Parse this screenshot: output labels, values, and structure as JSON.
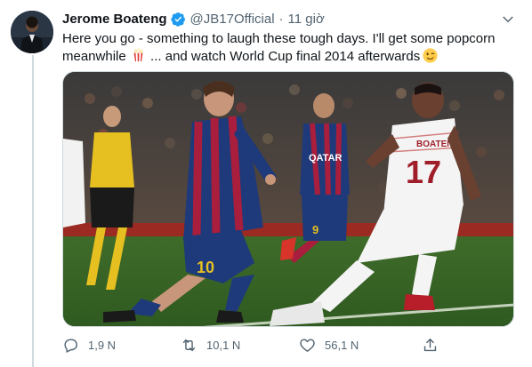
{
  "tweet": {
    "display_name": "Jerome Boateng",
    "handle": "@JB17Official",
    "separator": "·",
    "timestamp": "11 giờ",
    "text_part1": "Here you go - something to laugh these tough days. I'll get some popcorn meanwhile",
    "text_part2": " ... and watch World Cup final 2014 afterwards",
    "emoji_popcorn": "popcorn-emoji",
    "emoji_wink": "winking-face-emoji",
    "verified_color": "#1d9bf0"
  },
  "media": {
    "jersey_number_left": "10",
    "jersey_name_right": "BOATENG",
    "jersey_number_right": "17",
    "jersey_number_bg_player": "9",
    "sponsor_text": "QATAR"
  },
  "actions": {
    "reply_count": "1,9 N",
    "retweet_count": "10,1 N",
    "like_count": "56,1 N",
    "icons": [
      "reply-icon",
      "retweet-icon",
      "like-icon",
      "share-icon"
    ]
  }
}
